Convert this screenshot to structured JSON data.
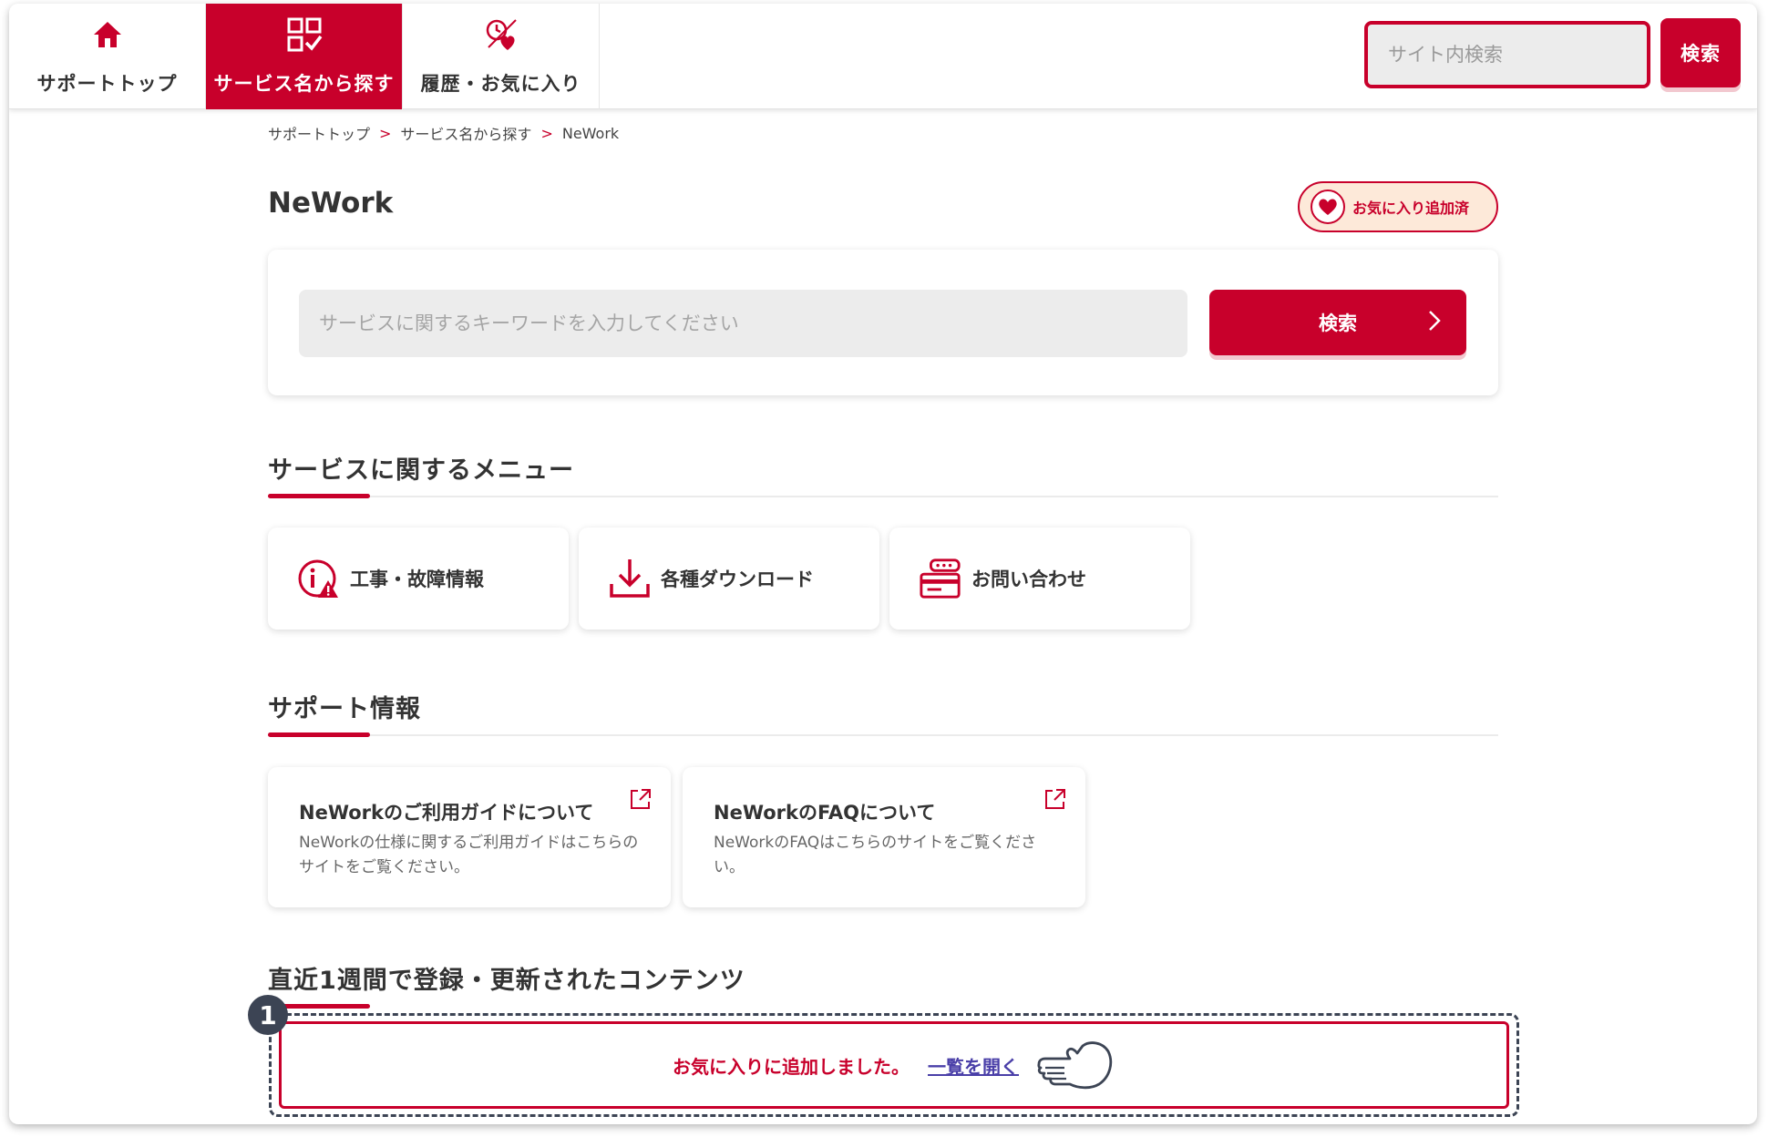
{
  "nav": {
    "tabs": [
      {
        "label": "サポートトップ",
        "icon": "home-icon"
      },
      {
        "label": "サービス名から探す",
        "icon": "grid-check-icon"
      },
      {
        "label": "履歴・お気に入り",
        "icon": "history-heart-icon"
      }
    ],
    "site_search": {
      "placeholder": "サイト内検索",
      "button": "検索"
    }
  },
  "breadcrumb": [
    "サポートトップ",
    "サービス名から探す",
    "NeWork"
  ],
  "page": {
    "title": "NeWork",
    "favorite_badge": "お気に入り追加済"
  },
  "service_search": {
    "placeholder": "サービスに関するキーワードを入力してください",
    "button": "検索"
  },
  "menu": {
    "title": "サービスに関するメニュー",
    "items": [
      {
        "label": "工事・故障情報",
        "icon": "info-warning-icon"
      },
      {
        "label": "各種ダウンロード",
        "icon": "download-icon"
      },
      {
        "label": "お問い合わせ",
        "icon": "inquiry-icon"
      }
    ]
  },
  "support": {
    "title": "サポート情報",
    "cards": [
      {
        "title": "NeWorkのご利用ガイドについて",
        "desc": "NeWorkの仕様に関するご利用ガイドはこちらのサイトをご覧ください。"
      },
      {
        "title": "NeWorkのFAQについて",
        "desc": "NeWorkのFAQはこちらのサイトをご覧ください。"
      }
    ]
  },
  "recent": {
    "title": "直近1週間で登録・更新されたコンテンツ"
  },
  "toast": {
    "message": "お気に入りに追加しました。",
    "link": "一覧を開く"
  },
  "annotation": {
    "step": "1"
  },
  "colors": {
    "accent": "#c8002b",
    "annotation": "#3c4454"
  }
}
